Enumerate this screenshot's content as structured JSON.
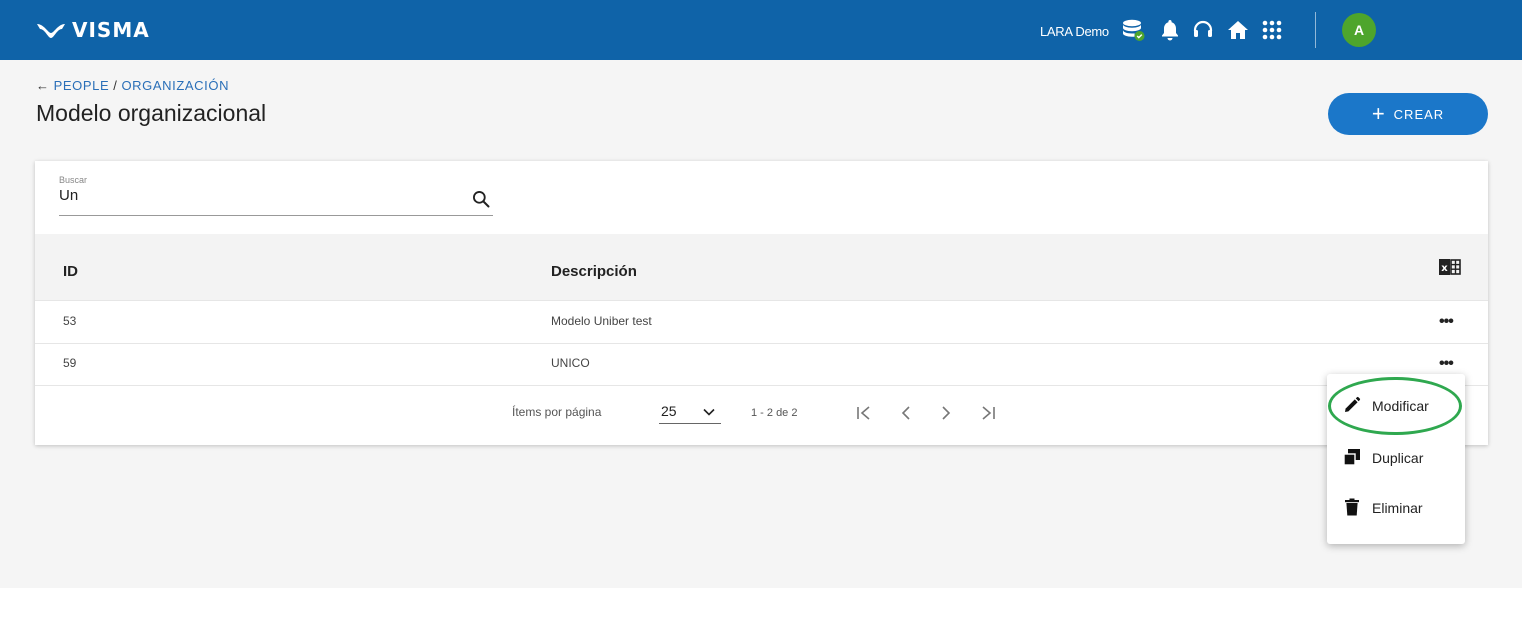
{
  "topbar": {
    "brand": "VISMA",
    "company": "LARA Demo",
    "avatar_initial": "A",
    "icons": [
      "database-check-icon",
      "bell-icon",
      "headset-icon",
      "home-icon",
      "apps-grid-icon"
    ]
  },
  "breadcrumb": {
    "back_icon": "arrow-left-icon",
    "items": [
      "PEOPLE",
      "ORGANIZACIÓN"
    ],
    "separator": "/"
  },
  "page": {
    "title": "Modelo organizacional",
    "create_label": "CREAR",
    "create_icon": "plus-icon"
  },
  "search": {
    "label": "Buscar",
    "value": "Un",
    "icon": "search-icon"
  },
  "table": {
    "columns": [
      "ID",
      "Descripción"
    ],
    "export_icon": "excel-icon",
    "rows": [
      {
        "id": "53",
        "description": "Modelo Uniber test",
        "menu": "•••"
      },
      {
        "id": "59",
        "description": "UNICO",
        "menu": "•••"
      }
    ]
  },
  "pager": {
    "items_per_page_label": "Ítems por página",
    "page_size": "25",
    "range": "1 - 2 de 2"
  },
  "context_menu": {
    "items": [
      {
        "label": "Modificar",
        "icon": "pencil-icon"
      },
      {
        "label": "Duplicar",
        "icon": "duplicate-icon"
      },
      {
        "label": "Eliminar",
        "icon": "trash-icon"
      }
    ]
  },
  "colors": {
    "topbar": "#0f63a8",
    "primary_button": "#1b77c9",
    "avatar": "#4ea52c",
    "link": "#2a6fb8",
    "highlight": "#2fa84f"
  }
}
